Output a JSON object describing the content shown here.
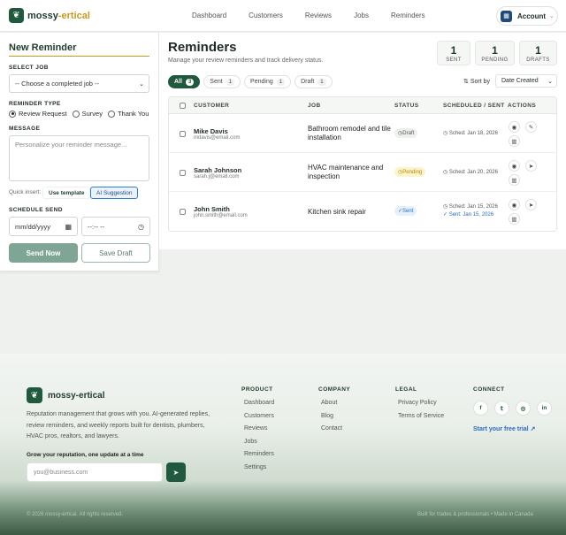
{
  "header": {
    "brand_main": "mossy",
    "brand_accent": "-ertical",
    "nav": [
      "Dashboard",
      "Customers",
      "Reviews",
      "Jobs",
      "Reminders"
    ],
    "account_label": "Account"
  },
  "form": {
    "title": "New Reminder",
    "select_job_label": "SELECT JOB",
    "select_job_value": "-- Choose a completed job --",
    "reminder_type_label": "REMINDER TYPE",
    "reminder_types": [
      "Review Request",
      "Survey",
      "Thank You"
    ],
    "reminder_type_selected": "Review Request",
    "message_label": "MESSAGE",
    "message_placeholder": "Personalize your reminder message...",
    "quick_insert_label": "Quick insert:",
    "use_template": "Use template",
    "ai_suggestion": "AI Suggestion",
    "schedule_label": "SCHEDULE SEND",
    "date_placeholder": "mm/dd/yyyy",
    "time_placeholder": "--:-- --",
    "send_now": "Send Now",
    "save_draft": "Save Draft"
  },
  "main": {
    "title": "Reminders",
    "subtitle": "Manage your review reminders and track delivery status.",
    "stats": [
      {
        "value": "1",
        "label": "SENT"
      },
      {
        "value": "1",
        "label": "PENDING"
      },
      {
        "value": "1",
        "label": "DRAFTS"
      }
    ],
    "tabs": [
      {
        "label": "All",
        "count": "3"
      },
      {
        "label": "Sent",
        "count": "1"
      },
      {
        "label": "Pending",
        "count": "1"
      },
      {
        "label": "Draft",
        "count": "1"
      }
    ],
    "sort_label": "Sort by",
    "sort_value": "Date Created",
    "columns": [
      "CUSTOMER",
      "JOB",
      "STATUS",
      "SCHEDULED / SENT",
      "ACTIONS"
    ],
    "rows": [
      {
        "name": "Mike Davis",
        "email": "mdavis@email.com",
        "job": "Bathroom remodel and tile installation",
        "status": "Draft",
        "sched": "Sched: Jan 18, 2026",
        "sent": ""
      },
      {
        "name": "Sarah Johnson",
        "email": "sarah.j@email.com",
        "job": "HVAC maintenance and inspection",
        "status": "Pending",
        "sched": "Sched: Jan 20, 2026",
        "sent": ""
      },
      {
        "name": "John Smith",
        "email": "john.smith@email.com",
        "job": "Kitchen sink repair",
        "status": "Sent",
        "sched": "Sched: Jan 15, 2026",
        "sent": "Sent: Jan 15, 2026"
      }
    ]
  },
  "footer": {
    "brand": "mossy-ertical",
    "description": "Reputation management that grows with you. AI-generated replies, review reminders, and weekly reports built for dentists, plumbers, HVAC pros, realtors, and lawyers.",
    "newsletter_label": "Grow your reputation, one update at a time",
    "email_placeholder": "you@business.com",
    "product_heading": "PRODUCT",
    "product_links": [
      "Dashboard",
      "Customers",
      "Reviews",
      "Jobs",
      "Reminders",
      "Settings"
    ],
    "company_heading": "COMPANY",
    "company_links": [
      "About",
      "Blog",
      "Contact"
    ],
    "legal_heading": "LEGAL",
    "legal_links": [
      "Privacy Policy",
      "Terms of Service"
    ],
    "connect_heading": "CONNECT",
    "social": [
      "facebook-icon",
      "twitter-icon",
      "instagram-icon",
      "linkedin-icon"
    ],
    "trial_link": "Start your free trial",
    "copyright": "© 2026 mossy-ertical. All rights reserved.",
    "made_in": "Built for trades & professionals • Made in Canada"
  },
  "colors": {
    "brand_green": "#1f5a3e",
    "accent_gold": "#c89a1a",
    "link_blue": "#2a6bc2"
  }
}
